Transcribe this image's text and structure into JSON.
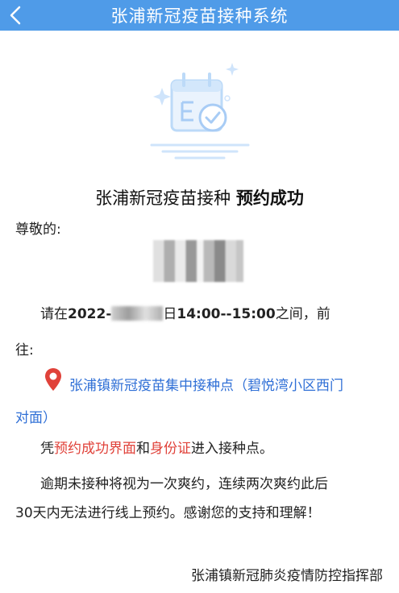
{
  "header": {
    "title": "张浦新冠疫苗接种系统",
    "back_icon": "chevron-left-icon"
  },
  "hero": {
    "icon": "calendar-check-icon"
  },
  "success": {
    "prefix": "张浦新冠疫苗接种 ",
    "emphasis": "预约成功"
  },
  "greeting": "尊敬的:",
  "appointment": {
    "before": "请在",
    "date_visible": "2022-",
    "date_suffix": "日",
    "time_range": "14:00--15:00",
    "after": "之间，前",
    "continuation": "往:"
  },
  "location": {
    "line1": "张浦镇新冠疫苗集中接种点（碧悦湾小区西门",
    "line2": "对面）",
    "icon": "location-pin-icon"
  },
  "certificate": {
    "t1": "凭",
    "r1": "预约成功界面",
    "t2": "和",
    "r2": "身份证",
    "t3": "进入接种点。"
  },
  "warning": {
    "line1": "逾期未接种将视为一次爽约，连续两次爽约此后",
    "line2": "30天内无法进行线上预约。感谢您的支持和理解！"
  },
  "signature": "张浦镇新冠肺炎疫情防控指挥部",
  "colors": {
    "header_bg": "#4f9be8",
    "link_blue": "#2f6fd6",
    "accent_red": "#e0423a",
    "icon_light_blue": "#bcdaf8"
  }
}
